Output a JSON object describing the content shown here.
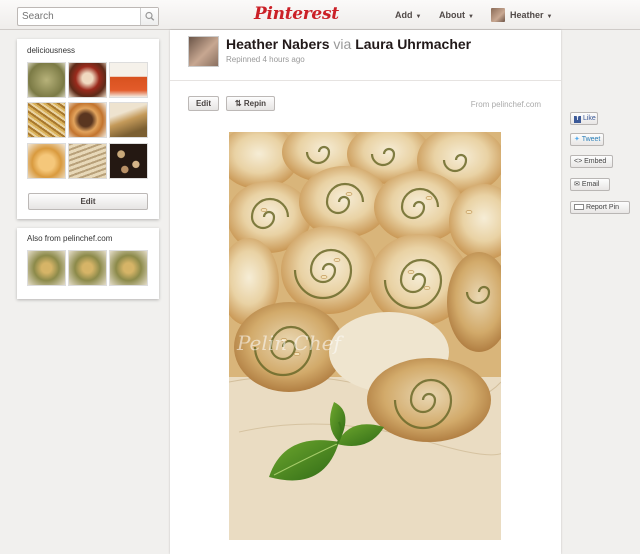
{
  "header": {
    "search_placeholder": "Search",
    "logo": "Pinterest",
    "add_label": "Add",
    "about_label": "About",
    "user_label": "Heather",
    "brand_color": "#cb2027"
  },
  "sidebar": {
    "board_title": "deliciousness",
    "board_edit_label": "Edit",
    "also_from_prefix": "Also from",
    "also_from_source": "pelinchef.com"
  },
  "pin": {
    "pinner": "Heather Nabers",
    "via_word": "via",
    "source_user": "Laura Uhrmacher",
    "time": "Repinned 4 hours ago",
    "edit_label": "Edit",
    "repin_label": "Repin",
    "from_text": "From pelinchef.com",
    "watermark": "Pelin Chef"
  },
  "social": {
    "like": "Like",
    "tweet": "Tweet",
    "embed": "Embed",
    "email": "Email",
    "report": "Report Pin"
  },
  "icons": [
    "search-icon",
    "caret-down-icon",
    "repin-icon",
    "facebook-icon",
    "twitter-icon",
    "embed-icon",
    "email-icon",
    "flag-icon"
  ]
}
